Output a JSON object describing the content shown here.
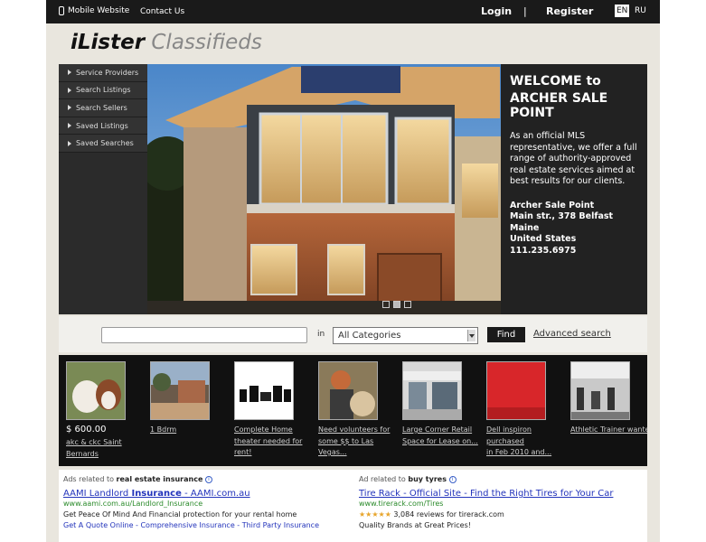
{
  "topbar": {
    "mobile_label": "Mobile Website",
    "contact_label": "Contact Us",
    "login_label": "Login",
    "separator": "|",
    "register_label": "Register",
    "lang_en": "EN",
    "lang_ru": "RU"
  },
  "logo": {
    "part1": "iLister",
    "part2": "Classifieds"
  },
  "sidenav": {
    "items": [
      {
        "label": "Service Providers"
      },
      {
        "label": "Search Listings"
      },
      {
        "label": "Search Sellers"
      },
      {
        "label": "Saved Listings"
      },
      {
        "label": "Saved Searches"
      }
    ]
  },
  "welcome": {
    "line1": "WELCOME to",
    "line2": "ARCHER SALE POINT",
    "description": "As an official MLS representative, we offer a full range of authority-approved real estate services aimed at best results for our clients.",
    "address": "Archer Sale Point\nMain str., 378 Belfast Maine\nUnited States\n111.235.6975"
  },
  "search": {
    "keyword_value": "",
    "in_label": "in",
    "category_value": "All Categories",
    "find_label": "Find",
    "advanced_label": "Advanced search"
  },
  "listings": [
    {
      "price": "$ 600.00",
      "title": "akc & ckc Saint\nBernards"
    },
    {
      "price": "",
      "title": "1 Bdrm"
    },
    {
      "price": "",
      "title": "Complete Home\ntheater needed for\nrent!"
    },
    {
      "price": "",
      "title": "Need volunteers for\nsome $$ to Las\nVegas..."
    },
    {
      "price": "",
      "title": "Large Corner Retail\nSpace for Lease on..."
    },
    {
      "price": "",
      "title": "Dell inspiron purchased\nin Feb 2010 and..."
    },
    {
      "price": "",
      "title": "Athletic Trainer wanted"
    }
  ],
  "ads": {
    "left": {
      "head_prefix": "Ads related to",
      "head_topic": "real estate insurance",
      "title_a": "AAMI Landlord ",
      "title_b": "Insurance",
      "title_c": " - AAMI.com.au",
      "url": "www.aami.com.au/Landlord_Insurance",
      "text": "Get Peace Of Mind And Financial protection for your rental home",
      "links": "Get A Quote Online - Comprehensive Insurance - Third Party Insurance"
    },
    "right": {
      "head_prefix": "Ad related to",
      "head_topic": "buy tyres",
      "title": "Tire Rack - Official Site - Find the Right Tires for Your Car",
      "url": "www.tirerack.com/Tires",
      "stars": "★★★★★",
      "rating_text": "3,084 reviews for tirerack.com",
      "text": "Quality Brands at Great Prices!"
    }
  },
  "colors": {
    "topbar": "#1a1a1a",
    "link_blue": "#2233bb",
    "ad_url_green": "#2a8a2a"
  }
}
